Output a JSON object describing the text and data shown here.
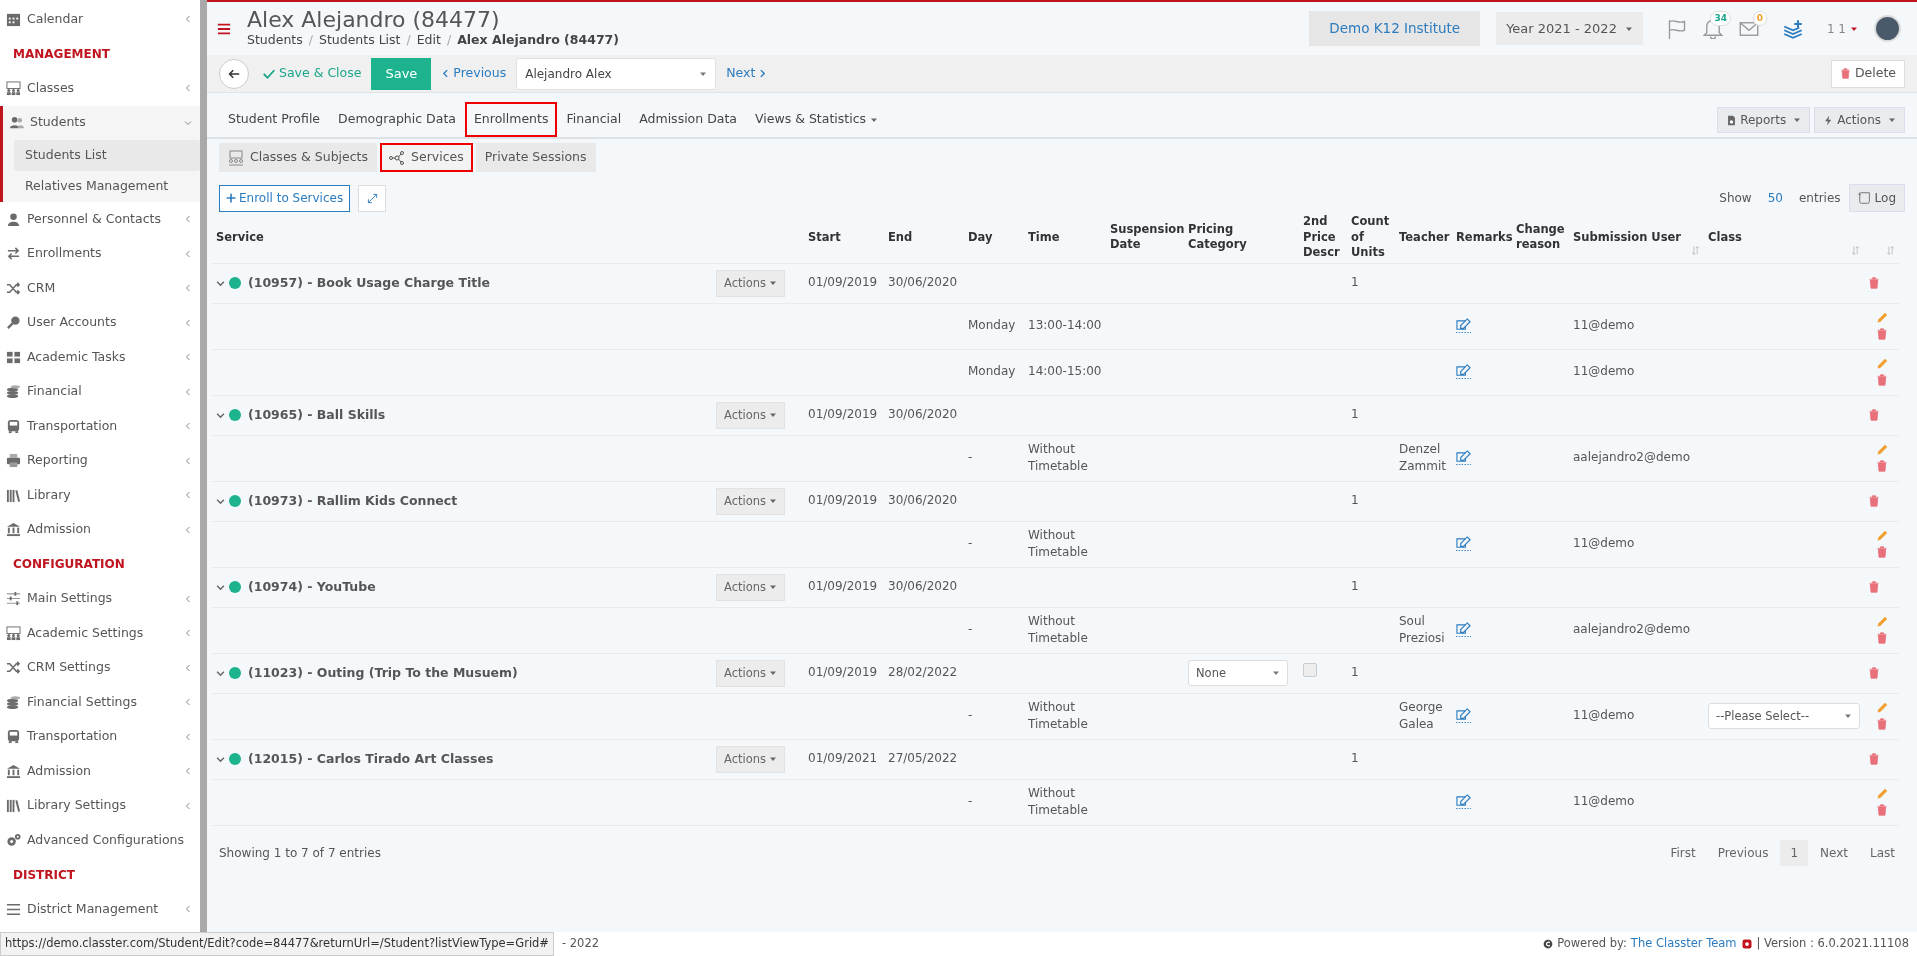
{
  "sidebar": {
    "items": [
      {
        "kind": "item",
        "label": "Calendar",
        "expanded": false
      },
      {
        "kind": "heading",
        "label": "MANAGEMENT"
      },
      {
        "kind": "item",
        "label": "Classes",
        "expanded": false
      },
      {
        "kind": "item",
        "label": "Students",
        "expanded": true,
        "children": [
          {
            "label": "Students List",
            "selected": true
          },
          {
            "label": "Relatives Management",
            "selected": false
          }
        ]
      },
      {
        "kind": "item",
        "label": "Personnel & Contacts",
        "expanded": false
      },
      {
        "kind": "item",
        "label": "Enrollments",
        "expanded": false
      },
      {
        "kind": "item",
        "label": "CRM",
        "expanded": false
      },
      {
        "kind": "item",
        "label": "User Accounts",
        "expanded": false
      },
      {
        "kind": "item",
        "label": "Academic Tasks",
        "expanded": false
      },
      {
        "kind": "item",
        "label": "Financial",
        "expanded": false
      },
      {
        "kind": "item",
        "label": "Transportation",
        "expanded": false
      },
      {
        "kind": "item",
        "label": "Reporting",
        "expanded": false
      },
      {
        "kind": "item",
        "label": "Library",
        "expanded": false
      },
      {
        "kind": "item",
        "label": "Admission",
        "expanded": false
      },
      {
        "kind": "heading",
        "label": "CONFIGURATION"
      },
      {
        "kind": "item",
        "label": "Main Settings",
        "expanded": false
      },
      {
        "kind": "item",
        "label": "Academic Settings",
        "expanded": false
      },
      {
        "kind": "item",
        "label": "CRM Settings",
        "expanded": false
      },
      {
        "kind": "item",
        "label": "Financial Settings",
        "expanded": false
      },
      {
        "kind": "item",
        "label": "Transportation",
        "expanded": false
      },
      {
        "kind": "item",
        "label": "Admission",
        "expanded": false
      },
      {
        "kind": "item",
        "label": "Library Settings",
        "expanded": false
      },
      {
        "kind": "item",
        "label": "Advanced Configurations"
      },
      {
        "kind": "heading",
        "label": "DISTRICT"
      },
      {
        "kind": "item",
        "label": "District Management",
        "expanded": false
      }
    ]
  },
  "header": {
    "title": "Alex Alejandro (84477)",
    "breadcrumb": [
      "Students",
      "Students List",
      "Edit",
      "Alex Alejandro (84477)"
    ],
    "breadcrumb_separator": "/",
    "institute": "Demo K12 Institute",
    "year": "Year 2021 - 2022",
    "notifications_count": "34",
    "messages_count": "0",
    "user": "1 1"
  },
  "toolbar": {
    "save_close": "Save & Close",
    "save": "Save",
    "previous": "Previous",
    "student_select": "Alejandro Alex",
    "next": "Next",
    "delete": "Delete"
  },
  "tabs": [
    {
      "label": "Student Profile",
      "selected": false,
      "has_menu": false
    },
    {
      "label": "Demographic Data",
      "selected": false,
      "has_menu": false
    },
    {
      "label": "Enrollments",
      "selected": true,
      "has_menu": false
    },
    {
      "label": "Financial",
      "selected": false,
      "has_menu": false
    },
    {
      "label": "Admission Data",
      "selected": false,
      "has_menu": false
    },
    {
      "label": "Views & Statistics",
      "selected": false,
      "has_menu": true
    }
  ],
  "tab_buttons": [
    "Reports",
    "Actions"
  ],
  "subtabs": [
    {
      "label": "Classes & Subjects",
      "selected": false
    },
    {
      "label": "Services",
      "selected": true
    },
    {
      "label": "Private Sessions",
      "selected": false
    }
  ],
  "list_controls": {
    "enroll": "Enroll to Services",
    "show": "Show",
    "page_size": "50",
    "entries": "entries",
    "log": "Log"
  },
  "table": {
    "columns": [
      "Service",
      "",
      "Start",
      "End",
      "Day",
      "Time",
      "Suspension Date",
      "Pricing Category",
      "2nd Price Descr",
      "Count of Units",
      "Teacher",
      "Remarks",
      "Change reason",
      "Submission User",
      "Class",
      ""
    ],
    "services": [
      {
        "title": "(10957) - Book Usage Charge Title",
        "expanded": true,
        "actions": "Actions",
        "start": "01/09/2019",
        "end": "30/06/2020",
        "count": "1",
        "sessions": [
          {
            "day": "Monday",
            "time": "13:00-14:00",
            "user": "11@demo"
          },
          {
            "day": "Monday",
            "time": "14:00-15:00",
            "user": "11@demo"
          }
        ]
      },
      {
        "title": "(10965) - Ball Skills",
        "expanded": true,
        "actions": "Actions",
        "start": "01/09/2019",
        "end": "30/06/2020",
        "count": "1",
        "sessions": [
          {
            "day": "-",
            "time": "Without Timetable",
            "teacher": "Denzel Zammit",
            "user": "aalejandro2@demo"
          }
        ]
      },
      {
        "title": "(10973) - Rallim Kids Connect",
        "expanded": true,
        "actions": "Actions",
        "start": "01/09/2019",
        "end": "30/06/2020",
        "count": "1",
        "sessions": [
          {
            "day": "-",
            "time": "Without Timetable",
            "user": "11@demo"
          }
        ]
      },
      {
        "title": "(10974) - YouTube",
        "expanded": true,
        "actions": "Actions",
        "start": "01/09/2019",
        "end": "30/06/2020",
        "count": "1",
        "sessions": [
          {
            "day": "-",
            "time": "Without Timetable",
            "teacher": "Soul Preziosi",
            "user": "aalejandro2@demo"
          }
        ]
      },
      {
        "title": "(11023) - Outing (Trip To the Musuem)",
        "expanded": true,
        "actions": "Actions",
        "start": "01/09/2019",
        "end": "28/02/2022",
        "pricing_category": "None",
        "second_price_checked": false,
        "count": "1",
        "sessions": [
          {
            "day": "-",
            "time": "Without Timetable",
            "teacher": "George Galea",
            "user": "11@demo",
            "class_select": "--Please Select--"
          }
        ]
      },
      {
        "title": "(12015) - Carlos Tirado Art Classes",
        "expanded": true,
        "actions": "Actions",
        "start": "01/09/2021",
        "end": "27/05/2022",
        "count": "1",
        "sessions": [
          {
            "day": "-",
            "time": "Without Timetable",
            "user": "11@demo"
          }
        ]
      }
    ]
  },
  "footer": {
    "info": "Showing 1 to 7 of 7 entries",
    "pagination": [
      {
        "label": "First",
        "selected": false
      },
      {
        "label": "Previous",
        "selected": false
      },
      {
        "label": "1",
        "selected": true
      },
      {
        "label": "Next",
        "selected": false
      },
      {
        "label": "Last",
        "selected": false
      }
    ]
  },
  "status_bar": {
    "url": "https://demo.classter.com/Student/Edit?code=84477&returnUrl=/Student?listViewType=Grid#",
    "copyright_tail": "- 2022",
    "powered_by": "Powered by:",
    "team": "The Classter Team",
    "version": "| Version : 6.0.2021.11108"
  }
}
